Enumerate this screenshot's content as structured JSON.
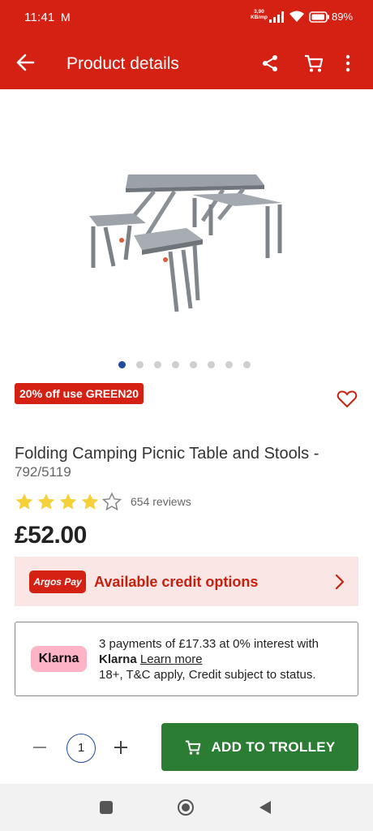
{
  "status_bar": {
    "time": "11:41",
    "mail_icon": "M",
    "net_speed_value": "3,90",
    "net_speed_unit": "KB/mp",
    "battery": "89%"
  },
  "app_bar": {
    "title": "Product details",
    "icons": [
      "back-arrow-icon",
      "share-icon",
      "cart-icon",
      "more-vert-icon"
    ]
  },
  "gallery": {
    "total_images": 8,
    "active_index": 0
  },
  "promo_badge": "20% off use GREEN20",
  "product": {
    "title": "Folding Camping Picnic Table and Stools -",
    "sku": "792/5119",
    "rating": 4,
    "rating_max": 5,
    "reviews": "654 reviews",
    "price": "£52.00"
  },
  "credit": {
    "logo_text": "Argos Pay",
    "label": "Available credit options"
  },
  "klarna": {
    "logo_text": "Klarna",
    "line1": "3 payments of £17.33 at 0% interest with",
    "brand": "Klarna",
    "learn_more": "Learn more",
    "line3": "18+, T&C apply, Credit subject to status."
  },
  "quantity": {
    "value": "1"
  },
  "add_button": {
    "label": "ADD TO TROLLEY"
  },
  "colors": {
    "brand_red": "#d42114",
    "button_green": "#2a7d33",
    "klarna_pink": "#ffb3c7",
    "star_yellow": "#f5d03b"
  }
}
